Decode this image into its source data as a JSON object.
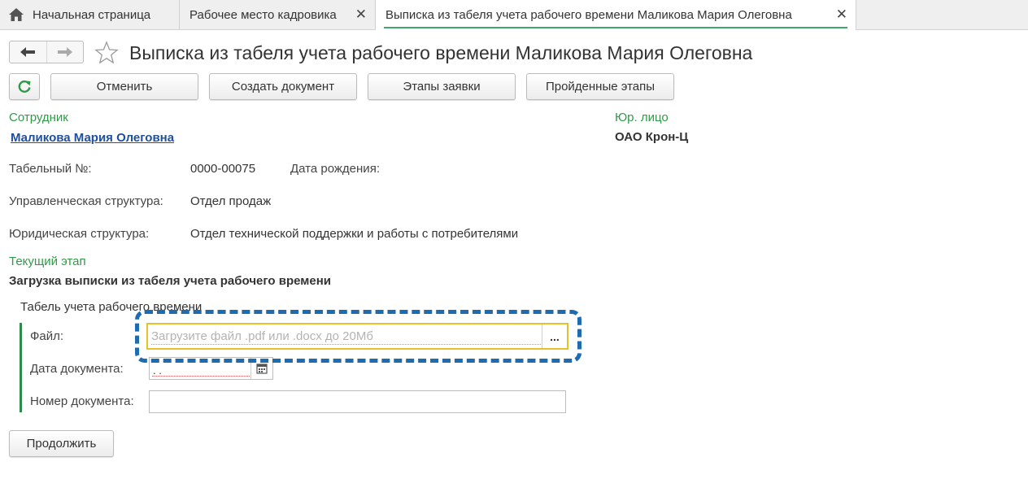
{
  "tabs": [
    {
      "label": "Начальная страница",
      "icon": "home-icon"
    },
    {
      "label": "Рабочее место кадровика",
      "close": "✕"
    },
    {
      "label": "Выписка из табеля учета рабочего времени Маликова Мария Олеговна",
      "close": "✕",
      "active": true
    }
  ],
  "page": {
    "title": "Выписка из табеля учета рабочего времени Маликова Мария Олеговна"
  },
  "toolbar": {
    "cancel": "Отменить",
    "create_document": "Создать документ",
    "stages": "Этапы заявки",
    "passed_stages": "Пройденные этапы"
  },
  "employee": {
    "header": "Сотрудник",
    "name": "Маликова Мария Олеговна"
  },
  "legal_entity": {
    "header": "Юр. лицо",
    "name": "ОАО Крон-Ц"
  },
  "fields": {
    "tab_number_label": "Табельный №:",
    "tab_number_value": "0000-00075",
    "birth_date_label": "Дата рождения:",
    "mgmt_structure_label": "Управленческая структура:",
    "mgmt_structure_value": "Отдел продаж",
    "legal_structure_label": "Юридическая структура:",
    "legal_structure_value": "Отдел технической поддержки и работы с потребителями"
  },
  "stage": {
    "header": "Текущий этап",
    "name": "Загрузка выписки из табеля учета рабочего времени"
  },
  "timesheet": {
    "group_title": "Табель учета рабочего времени",
    "file_label": "Файл:",
    "file_placeholder": "Загрузите файл .pdf или .docx до 20Мб",
    "file_button": "...",
    "doc_date_label": "Дата документа:",
    "doc_date_value": ". .",
    "doc_number_label": "Номер документа:",
    "doc_number_value": ""
  },
  "continue_button": "Продолжить",
  "colors": {
    "accent_green": "#2f9b47",
    "link_blue": "#1f4fa0",
    "highlight_dashed": "#1e6bb0",
    "file_focus_border": "#e8c02a"
  }
}
